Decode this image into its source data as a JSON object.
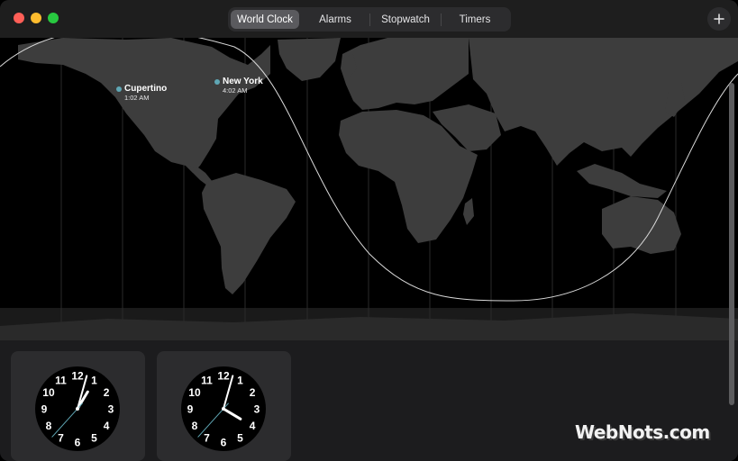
{
  "window": {
    "tabs": [
      {
        "label": "World Clock",
        "active": true
      },
      {
        "label": "Alarms",
        "active": false
      },
      {
        "label": "Stopwatch",
        "active": false
      },
      {
        "label": "Timers",
        "active": false
      }
    ],
    "add_icon": "plus-icon"
  },
  "map": {
    "cities": [
      {
        "name": "Cupertino",
        "time": "1:02 AM"
      },
      {
        "name": "New York",
        "time": "4:02 AM"
      }
    ],
    "pin_color": "#5fa7b5"
  },
  "clocks": [
    {
      "city": "Cupertino",
      "hour": 1,
      "minute": 2,
      "second": 37
    },
    {
      "city": "New York",
      "hour": 4,
      "minute": 2,
      "second": 37
    }
  ],
  "clock_face_numbers": [
    "12",
    "1",
    "2",
    "3",
    "4",
    "5",
    "6",
    "7",
    "8",
    "9",
    "10",
    "11"
  ],
  "watermark": "WebNots.com",
  "colors": {
    "second_hand": "#5fa7b5",
    "face": "#000000",
    "card": "#2c2c2e"
  }
}
